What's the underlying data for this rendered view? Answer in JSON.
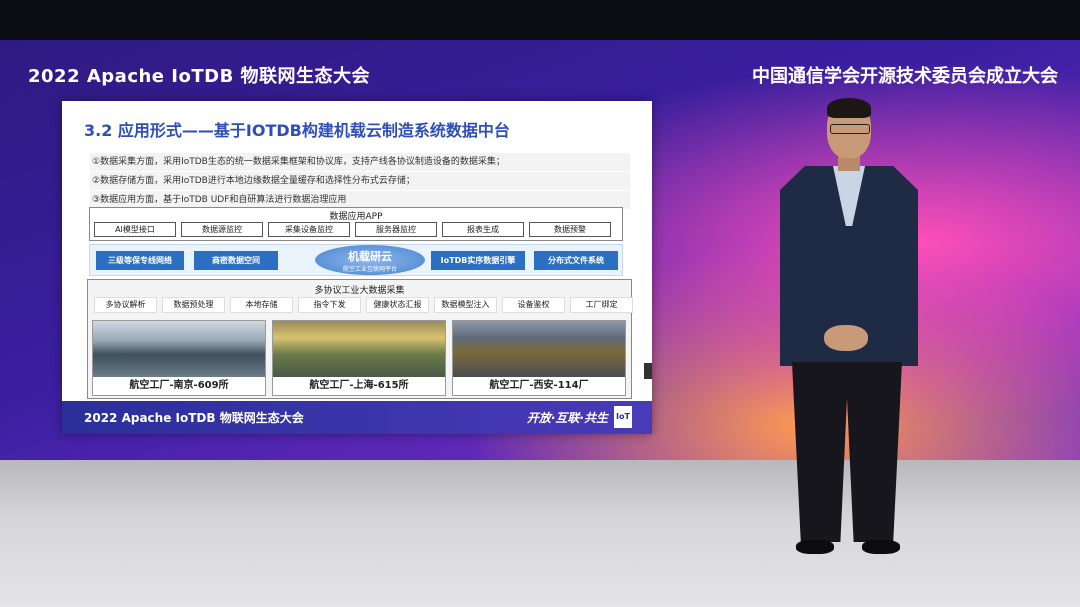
{
  "banner": {
    "left": "2022 Apache IoTDB 物联网生态大会",
    "right": "中国通信学会开源技术委员会成立大会"
  },
  "slide": {
    "title": "3.2 应用形式——基于IOTDB构建机载云制造系统数据中台",
    "bullets": [
      "①数据采集方面，采用IoTDB生态的统一数据采集框架和协议库，支持产线各协议制造设备的数据采集；",
      "②数据存储方面，采用IoTDB进行本地边缘数据全量缓存和选择性分布式云存储；",
      "③数据应用方面，基于IoTDB UDF和自研算法进行数据治理应用"
    ],
    "app_layer": {
      "caption": "数据应用APP",
      "items": [
        "AI模型接口",
        "数据源监控",
        "采集设备监控",
        "服务器监控",
        "报表生成",
        "数据预警"
      ]
    },
    "platform_layer": {
      "left_items": [
        "三级等保专线网络",
        "商密数据空间"
      ],
      "cloud_title": "机载研云",
      "cloud_subtitle": "航空工业互联网平台",
      "right_items": [
        "IoTDB实序数据引擎",
        "分布式文件系统"
      ]
    },
    "collect_layer": {
      "caption": "多协议工业大数据采集",
      "items": [
        "多协议解析",
        "数据预处理",
        "本地存储",
        "指令下发",
        "健康状态汇报",
        "数据模型注入",
        "设备鉴权",
        "工厂绑定"
      ]
    },
    "factories": [
      "航空工厂-南京-609所",
      "航空工厂-上海-615所",
      "航空工厂-西安-114厂"
    ],
    "footer": {
      "left": "2022 Apache IoTDB 物联网生态大会",
      "right": "开放·互联·共生",
      "logo": "IoT"
    }
  }
}
